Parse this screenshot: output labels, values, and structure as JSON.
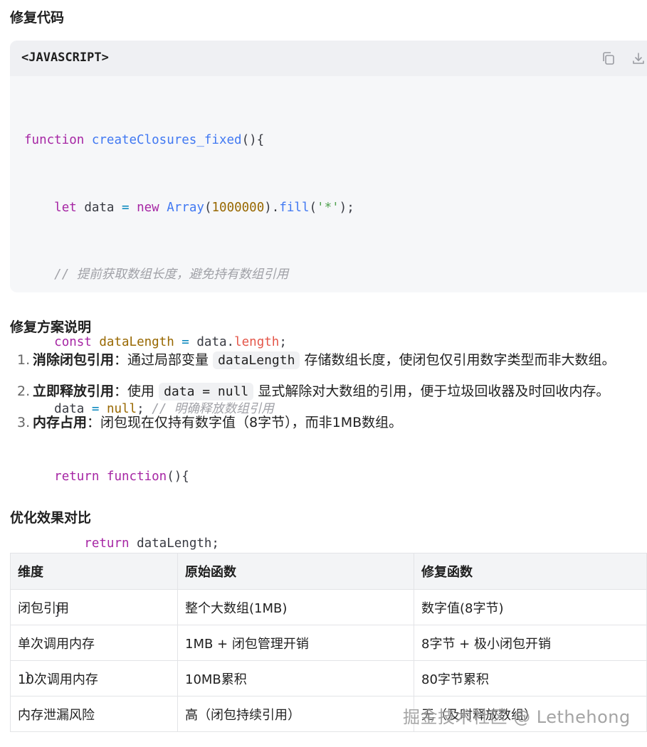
{
  "headings": {
    "fix_code": "修复代码",
    "explanation": "修复方案说明",
    "comparison": "优化效果对比"
  },
  "code_block": {
    "language": "<JAVASCRIPT>",
    "copy_icon": "copy-icon",
    "download_icon": "download-icon",
    "lines": [
      "function createClosures_fixed(){",
      "    let data = new Array(1000000).fill('*');",
      "    // 提前获取数组长度，避免持有数组引用",
      "    const dataLength = data.length;",
      "    data = null; // 明确释放数组引用",
      "    return function(){",
      "        return dataLength;",
      "    }",
      "}"
    ],
    "tokens": {
      "function": "function",
      "fn_name": "createClosures_fixed",
      "paren_open": "(){",
      "let": "let",
      "data": "data",
      "eq": "=",
      "new": "new",
      "array": "Array",
      "lp": "(",
      "million": "1000000",
      "rp_fill": ").",
      "fill": "fill",
      "str": "'*'",
      "end_fill": ");",
      "comment1": "// 提前获取数组长度，避免持有数组引用",
      "const": "const",
      "data_length": "dataLength",
      "dot": ".",
      "length": "length",
      "semi": ";",
      "null": "null",
      "comment2": "// 明确释放数组引用",
      "return": "return",
      "close_inner": "}",
      "close_outer": "}"
    }
  },
  "explanation_list": [
    {
      "num": "1.",
      "title": "消除闭包引用",
      "text_before": "：通过局部变量 ",
      "code": "dataLength",
      "text_after": " 存储数组长度，使闭包仅引用数字类型而非大数组。"
    },
    {
      "num": "2.",
      "title": "立即释放引用",
      "text_before": "：使用 ",
      "code": "data = null",
      "text_after": " 显式解除对大数组的引用，便于垃圾回收器及时回收内存。"
    },
    {
      "num": "3.",
      "title": "内存占用",
      "text_before": "：闭包现在仅持有数字值（8字节），而非1MB数组。",
      "code": "",
      "text_after": ""
    }
  ],
  "table": {
    "headers": [
      "维度",
      "原始函数",
      "修复函数"
    ],
    "rows": [
      [
        "闭包引用",
        "整个大数组(1MB)",
        "数字值(8字节)"
      ],
      [
        "单次调用内存",
        "1MB + 闭包管理开销",
        "8字节 + 极小闭包开销"
      ],
      [
        "10次调用内存",
        "10MB累积",
        "80字节累积"
      ],
      [
        "内存泄漏风险",
        "高（闭包持续引用）",
        "无（及时释放数组）"
      ]
    ]
  },
  "watermark": "掘金技术社区 @ Lethehong"
}
